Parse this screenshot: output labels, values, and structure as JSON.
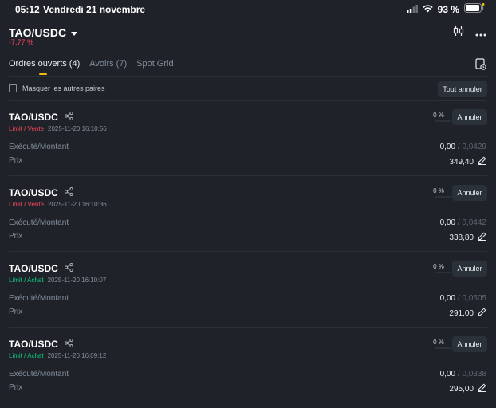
{
  "status_bar": {
    "time": "05:12",
    "date": "Vendredi 21 novembre",
    "battery": "93 %"
  },
  "header": {
    "pair": "TAO/USDC",
    "change": "-7,77 %"
  },
  "tabs": [
    {
      "label": "Ordres ouverts (4)",
      "active": true
    },
    {
      "label": "Avoirs (7)",
      "active": false
    },
    {
      "label": "Spot Grid",
      "active": false
    }
  ],
  "filter": {
    "hide_other_pairs": "Masquer les autres paires",
    "cancel_all": "Tout annuler"
  },
  "labels": {
    "executed_amount": "Exécuté/Montant",
    "price": "Prix",
    "cancel": "Annuler"
  },
  "orders": [
    {
      "pair": "TAO/USDC",
      "type": "Limit / Vente",
      "side": "sell",
      "time": "2025-11-20 16:10:56",
      "pct": "0 %",
      "executed": "0,00",
      "amount": "/ 0,0429",
      "price": "349,40"
    },
    {
      "pair": "TAO/USDC",
      "type": "Limit / Vente",
      "side": "sell",
      "time": "2025-11-20 16:10:36",
      "pct": "0 %",
      "executed": "0,00",
      "amount": "/ 0,0442",
      "price": "338,80"
    },
    {
      "pair": "TAO/USDC",
      "type": "Limit / Achat",
      "side": "buy",
      "time": "2025-11-20 16:10:07",
      "pct": "0 %",
      "executed": "0,00",
      "amount": "/ 0,0505",
      "price": "291,00"
    },
    {
      "pair": "TAO/USDC",
      "type": "Limit / Achat",
      "side": "buy",
      "time": "2025-11-20 16:09:12",
      "pct": "0 %",
      "executed": "0,00",
      "amount": "/ 0,0338",
      "price": "295,00"
    }
  ]
}
